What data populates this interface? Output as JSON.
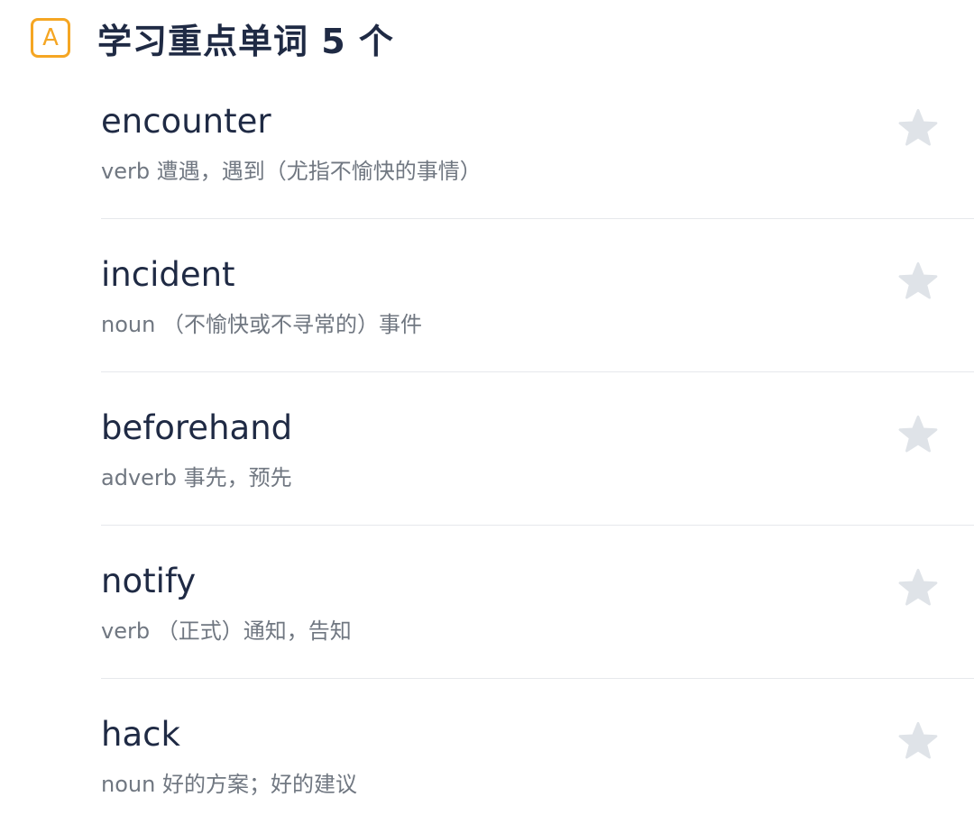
{
  "section": {
    "badge_letter": "A",
    "title": "学习重点单词 5 个"
  },
  "colors": {
    "accent": "#f5a623",
    "title_text": "#1f2a44",
    "definition_text": "#707781",
    "star": "#dfe3e8",
    "divider": "#e6e8ec"
  },
  "words": [
    {
      "word": "encounter",
      "definition": "verb 遭遇，遇到（尤指不愉快的事情）",
      "icon": "star-icon",
      "starred": false
    },
    {
      "word": "incident",
      "definition": "noun （不愉快或不寻常的）事件",
      "icon": "star-icon",
      "starred": false
    },
    {
      "word": "beforehand",
      "definition": "adverb 事先，预先",
      "icon": "star-icon",
      "starred": false
    },
    {
      "word": "notify",
      "definition": "verb （正式）通知，告知",
      "icon": "star-icon",
      "starred": false
    },
    {
      "word": "hack",
      "definition": "noun 好的方案；好的建议",
      "icon": "star-icon",
      "starred": false
    }
  ]
}
